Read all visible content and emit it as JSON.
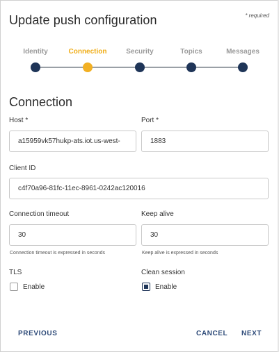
{
  "dialog": {
    "title": "Update push configuration",
    "required_note": "* required"
  },
  "stepper": {
    "steps": [
      {
        "label": "Identity",
        "active": false
      },
      {
        "label": "Connection",
        "active": true
      },
      {
        "label": "Security",
        "active": false
      },
      {
        "label": "Topics",
        "active": false
      },
      {
        "label": "Messages",
        "active": false
      }
    ]
  },
  "section": {
    "title": "Connection"
  },
  "fields": {
    "host": {
      "label": "Host *",
      "value": "a15959vk57hukp-ats.iot.us-west-"
    },
    "port": {
      "label": "Port *",
      "value": "1883"
    },
    "client_id": {
      "label": "Client ID",
      "value": "c4f70a96-81fc-11ec-8961-0242ac120016"
    },
    "connection_timeout": {
      "label": "Connection timeout",
      "value": "30",
      "helper": "Connection timeout is expressed in seconds"
    },
    "keep_alive": {
      "label": "Keep alive",
      "value": "30",
      "helper": "Keep alive is expressed in seconds"
    }
  },
  "options": {
    "tls": {
      "label": "TLS",
      "checkbox_label": "Enable",
      "checked": false
    },
    "clean_session": {
      "label": "Clean session",
      "checkbox_label": "Enable",
      "checked": true
    }
  },
  "buttons": {
    "previous": "PREVIOUS",
    "cancel": "CANCEL",
    "next": "NEXT"
  },
  "colors": {
    "accent": "#f2b023",
    "primary": "#1f3558",
    "button_text": "#2d4a78"
  }
}
